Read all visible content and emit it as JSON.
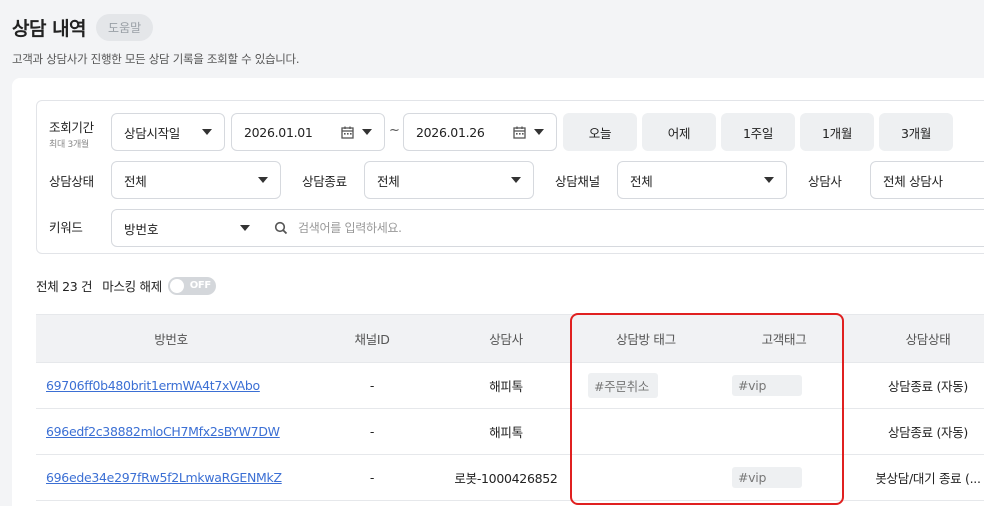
{
  "header": {
    "title": "상담 내역",
    "help_label": "도움말",
    "description": "고객과 상담사가 진행한 모든 상담 기록을 조회할 수 있습니다."
  },
  "filters": {
    "period_label": "조회기간",
    "period_sublabel": "최대 3개월",
    "date_type": "상담시작일",
    "start_date": "2026.01.01",
    "separator": "~",
    "end_date": "2026.01.26",
    "quick_ranges": [
      "오늘",
      "어제",
      "1주일",
      "1개월",
      "3개월"
    ],
    "status_label": "상담상태",
    "status_value": "전체",
    "end_type_label": "상담종료",
    "end_type_value": "전체",
    "channel_label": "상담채널",
    "channel_value": "전체",
    "agent_label": "상담사",
    "agent_value": "전체 상담사",
    "keyword_label": "키워드",
    "keyword_type": "방번호",
    "keyword_placeholder": "검색어를 입력하세요.",
    "keyword_value": ""
  },
  "summary": {
    "total": "전체 23 건",
    "masking_label": "마스킹 해제",
    "masking_toggle": "OFF"
  },
  "table": {
    "columns": [
      "방번호",
      "채널ID",
      "상담사",
      "상담방 태그",
      "고객태그",
      "상담상태"
    ],
    "rows": [
      {
        "room": "69706ff0b480brit1ermWA4t7xVAbo",
        "channel": "-",
        "agent": "해피톡",
        "room_tag": "#주문취소",
        "customer_tag": "#vip",
        "status": "상담종료 (자동)"
      },
      {
        "room": "696edf2c38882mloCH7Mfx2sBYW7DW",
        "channel": "-",
        "agent": "해피톡",
        "room_tag": "",
        "customer_tag": "",
        "status": "상담종료 (자동)"
      },
      {
        "room": "696ede34e297fRw5f2LmkwaRGENMkZ",
        "channel": "-",
        "agent": "로봇-1000426852",
        "room_tag": "",
        "customer_tag": "#vip",
        "status": "봇상담/대기 종료 (..."
      }
    ]
  },
  "colors": {
    "link": "#3b6fd4",
    "highlight": "#e02020",
    "header_bg": "#f1f2f4"
  }
}
